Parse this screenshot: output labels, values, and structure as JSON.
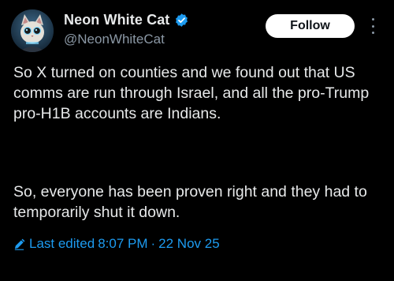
{
  "author": {
    "display_name": "Neon White Cat",
    "handle": "@NeonWhiteCat",
    "verified": true
  },
  "actions": {
    "follow_label": "Follow",
    "more_icon": "more-vertical-icon"
  },
  "tweet": {
    "paragraphs": [
      "So X turned on counties and we found out that US comms are run through Israel, and all the pro-Trump pro-H1B accounts are Indians.",
      "So, everyone has been proven right and they had to temporarily shut it down."
    ]
  },
  "edited": {
    "label": "Last edited",
    "time": "8:07 PM",
    "separator": "·",
    "date": "22 Nov 25",
    "icon": "pencil-icon"
  },
  "colors": {
    "background": "#000000",
    "text": "#e7e9ea",
    "secondary_text": "#8b98a5",
    "accent": "#1d9bf0",
    "follow_button_bg": "#ffffff"
  }
}
